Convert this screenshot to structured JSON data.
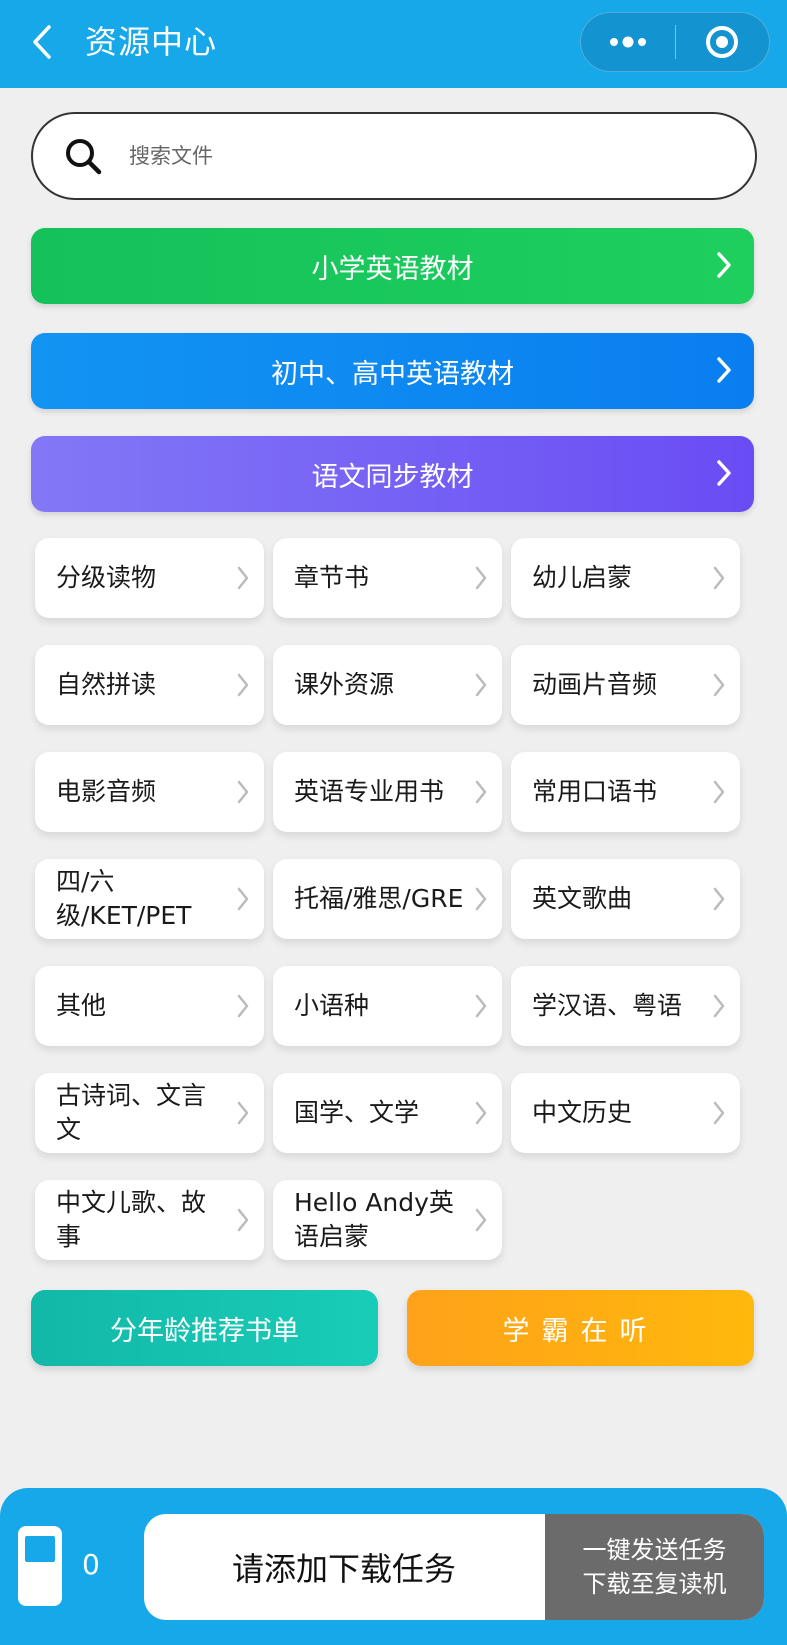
{
  "header": {
    "title": "资源中心",
    "back_icon": "chevron-left-icon",
    "more_icon": "more-dots-icon",
    "close_icon": "target-circle-icon",
    "background": "#17a8ea"
  },
  "search": {
    "placeholder": "搜索文件",
    "icon": "search-icon"
  },
  "main_categories": [
    {
      "label": "小学英语教材",
      "color": "#1ec65b"
    },
    {
      "label": "初中、高中英语教材",
      "color": "#0a86f2"
    },
    {
      "label": "语文同步教材",
      "color": "#7563f5"
    }
  ],
  "grid_items": [
    "分级读物",
    "章节书",
    "幼儿启蒙",
    "自然拼读",
    "课外资源",
    "动画片音频",
    "电影音频",
    "英语专业用书",
    "常用口语书",
    "四/六级/KET/PET",
    "托福/雅思/GRE",
    "英文歌曲",
    "其他",
    "小语种",
    "学汉语、粤语",
    "古诗词、文言文",
    "国学、文学",
    "中文历史",
    "中文儿歌、故事",
    "Hello Andy英语启蒙"
  ],
  "bottom_buttons": {
    "age_list": "分年龄推荐书单",
    "top_listening": "学霸在听"
  },
  "footer": {
    "device_icon": "reader-device-icon",
    "task_count": "0",
    "task_placeholder": "请添加下载任务",
    "send_line1": "一键发送任务",
    "send_line2": "下载至复读机"
  }
}
